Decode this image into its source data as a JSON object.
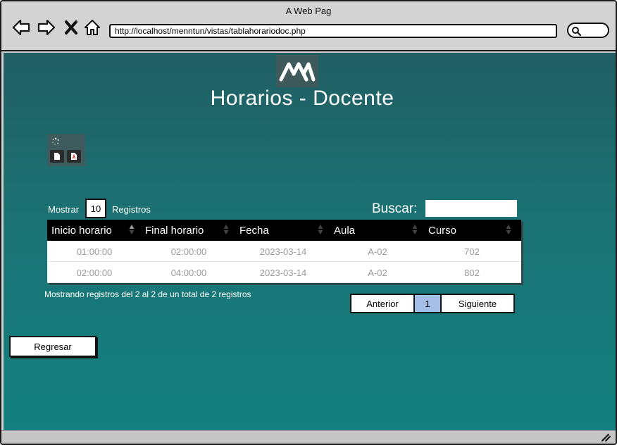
{
  "window": {
    "title": "A Web Pag"
  },
  "browser": {
    "url": "http://localhost/menntun/vistas/tablahorariodoc.php"
  },
  "page": {
    "title": "Horarios - Docente"
  },
  "length_control": {
    "prefix": "Mostrar",
    "value": "10",
    "suffix": "Registros"
  },
  "search": {
    "label": "Buscar:",
    "value": ""
  },
  "table": {
    "columns": [
      "Inicio horario",
      "Final horario",
      "Fecha",
      "Aula",
      "Curso"
    ],
    "rows": [
      [
        "01:00:00",
        "02:00:00",
        "2023-03-14",
        "A-02",
        "702"
      ],
      [
        "02:00:00",
        "04:00:00",
        "2023-03-14",
        "A-02",
        "802"
      ]
    ]
  },
  "info": "Mostrando registros del 2 al 2  de un total de 2 registros",
  "pagination": {
    "previous": "Anterior",
    "current_page": "1",
    "next": "Siguiente"
  },
  "back_button": "Regresar",
  "colors": {
    "background_top": "#215f63",
    "background_bottom": "#14807f",
    "table_header": "#000000",
    "active_page": "#a5c0e8"
  },
  "icons": [
    "back-arrow-icon",
    "forward-arrow-icon",
    "close-icon",
    "home-icon",
    "search-icon",
    "logo-icon",
    "spinner-icon",
    "file-icon",
    "pdf-file-icon",
    "sort-icon",
    "resize-icon"
  ]
}
